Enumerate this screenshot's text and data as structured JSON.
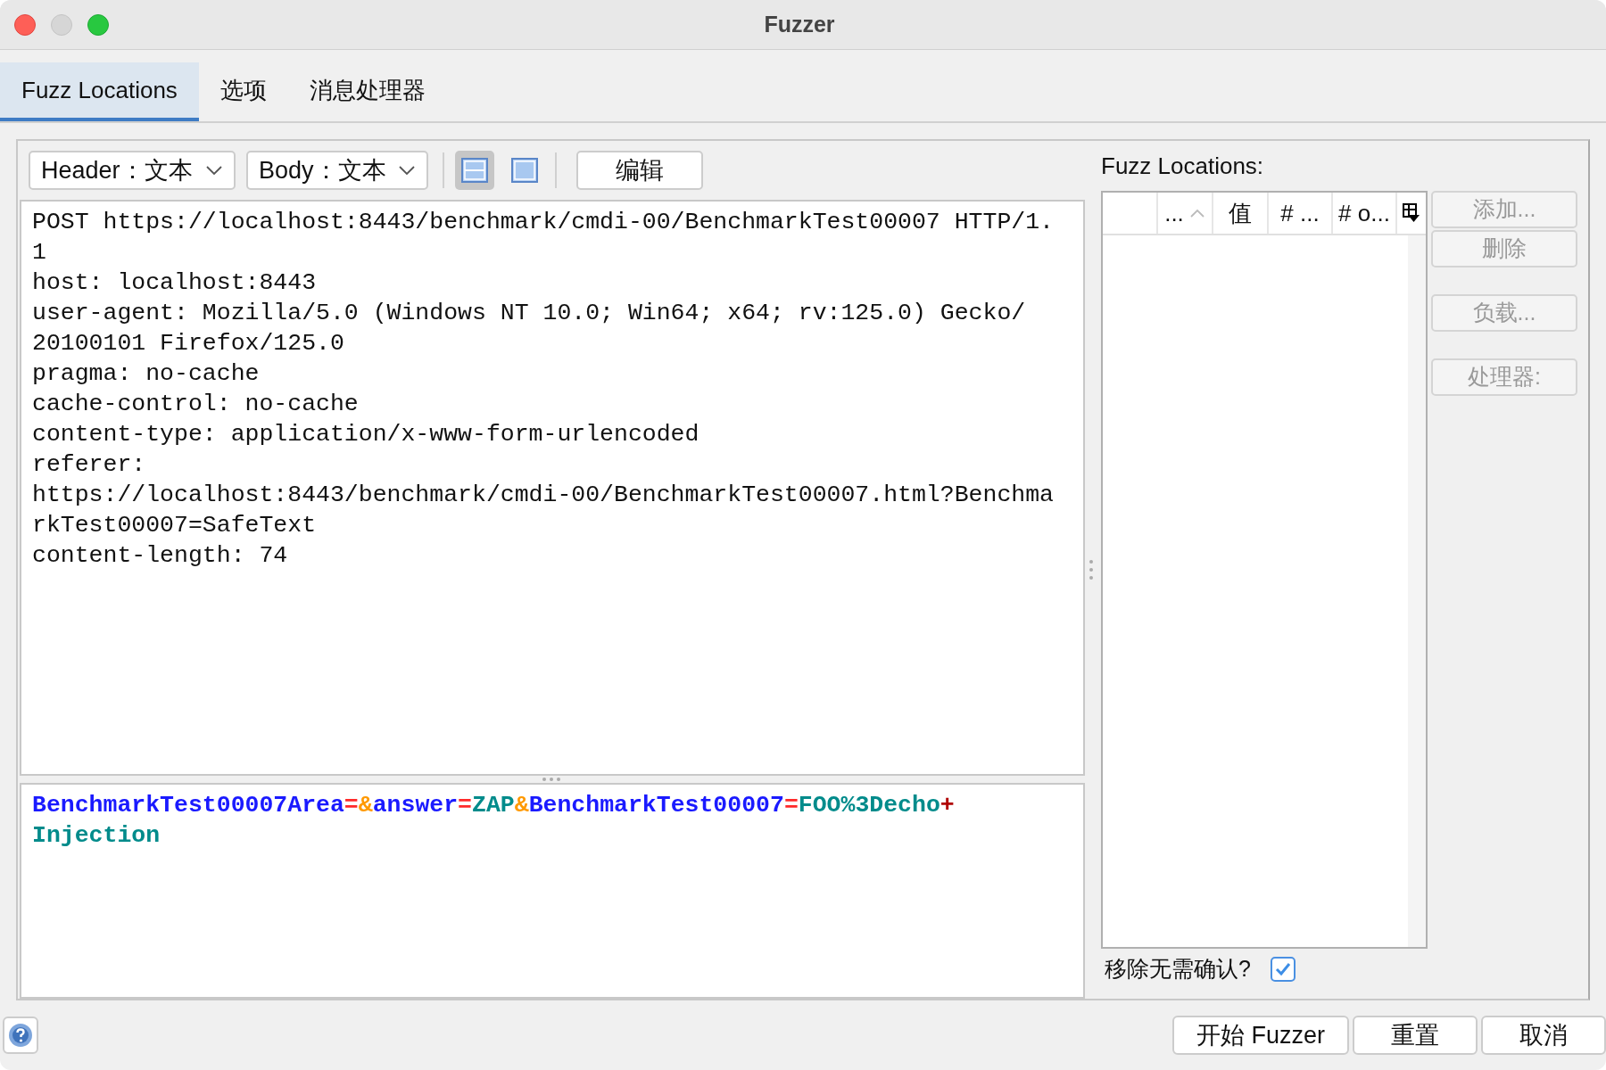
{
  "window": {
    "title": "Fuzzer"
  },
  "tabs": [
    {
      "label": "Fuzz Locations",
      "selected": true
    },
    {
      "label": "选项",
      "selected": false
    },
    {
      "label": "消息处理器",
      "selected": false
    }
  ],
  "toolbar": {
    "header_view": "Header：文本",
    "body_view": "Body：文本",
    "layouts": [
      {
        "kind": "split",
        "selected": true
      },
      {
        "kind": "single",
        "selected": false
      }
    ],
    "edit_button": "编辑"
  },
  "header_lines": [
    "POST https://localhost:8443/benchmark/cmdi-00/BenchmarkTest00007 HTTP/1.",
    "1",
    "host: localhost:8443",
    "user-agent: Mozilla/5.0 (Windows NT 10.0; Win64; x64; rv:125.0) Gecko/",
    "20100101 Firefox/125.0",
    "pragma: no-cache",
    "cache-control: no-cache",
    "content-type: application/x-www-form-urlencoded",
    "referer:",
    "https://localhost:8443/benchmark/cmdi-00/BenchmarkTest00007.html?Benchma",
    "rkTest00007=SafeText",
    "content-length: 74"
  ],
  "body_lines": [
    [
      {
        "text": "BenchmarkTest00007Area",
        "color": "#1a1aff"
      },
      {
        "text": "=",
        "color": "#ff2a2a"
      },
      {
        "text": "&",
        "color": "#ff9900"
      },
      {
        "text": "answer",
        "color": "#1a1aff"
      },
      {
        "text": "=",
        "color": "#ff2a2a"
      },
      {
        "text": "ZAP",
        "color": "#008b8b"
      },
      {
        "text": "&",
        "color": "#ff9900"
      },
      {
        "text": "BenchmarkTest00007",
        "color": "#1a1aff"
      },
      {
        "text": "=",
        "color": "#ff2a2a"
      },
      {
        "text": "FOO%3Decho",
        "color": "#008b8b"
      },
      {
        "text": "+",
        "color": "#b00000"
      }
    ],
    [
      {
        "text": "Injection",
        "color": "#008b8b"
      }
    ]
  ],
  "locations": {
    "label": "Fuzz Locations:",
    "columns": [
      {
        "sorted": false
      },
      {
        "label": "...",
        "sorted": true
      },
      {
        "label": "值",
        "sorted": false
      },
      {
        "label": "# ...",
        "sorted": false
      },
      {
        "label": "# o...",
        "sorted": false
      }
    ],
    "buttons": [
      {
        "label": "添加...",
        "disabled": true
      },
      {
        "label": "删除",
        "disabled": true
      },
      {
        "label": "负载...",
        "disabled": true
      },
      {
        "label": "处理器:",
        "disabled": true
      }
    ],
    "confirm": {
      "label": "移除无需确认?",
      "checked": true
    }
  },
  "footer_buttons": [
    "开始 Fuzzer",
    "重置",
    "取消"
  ]
}
